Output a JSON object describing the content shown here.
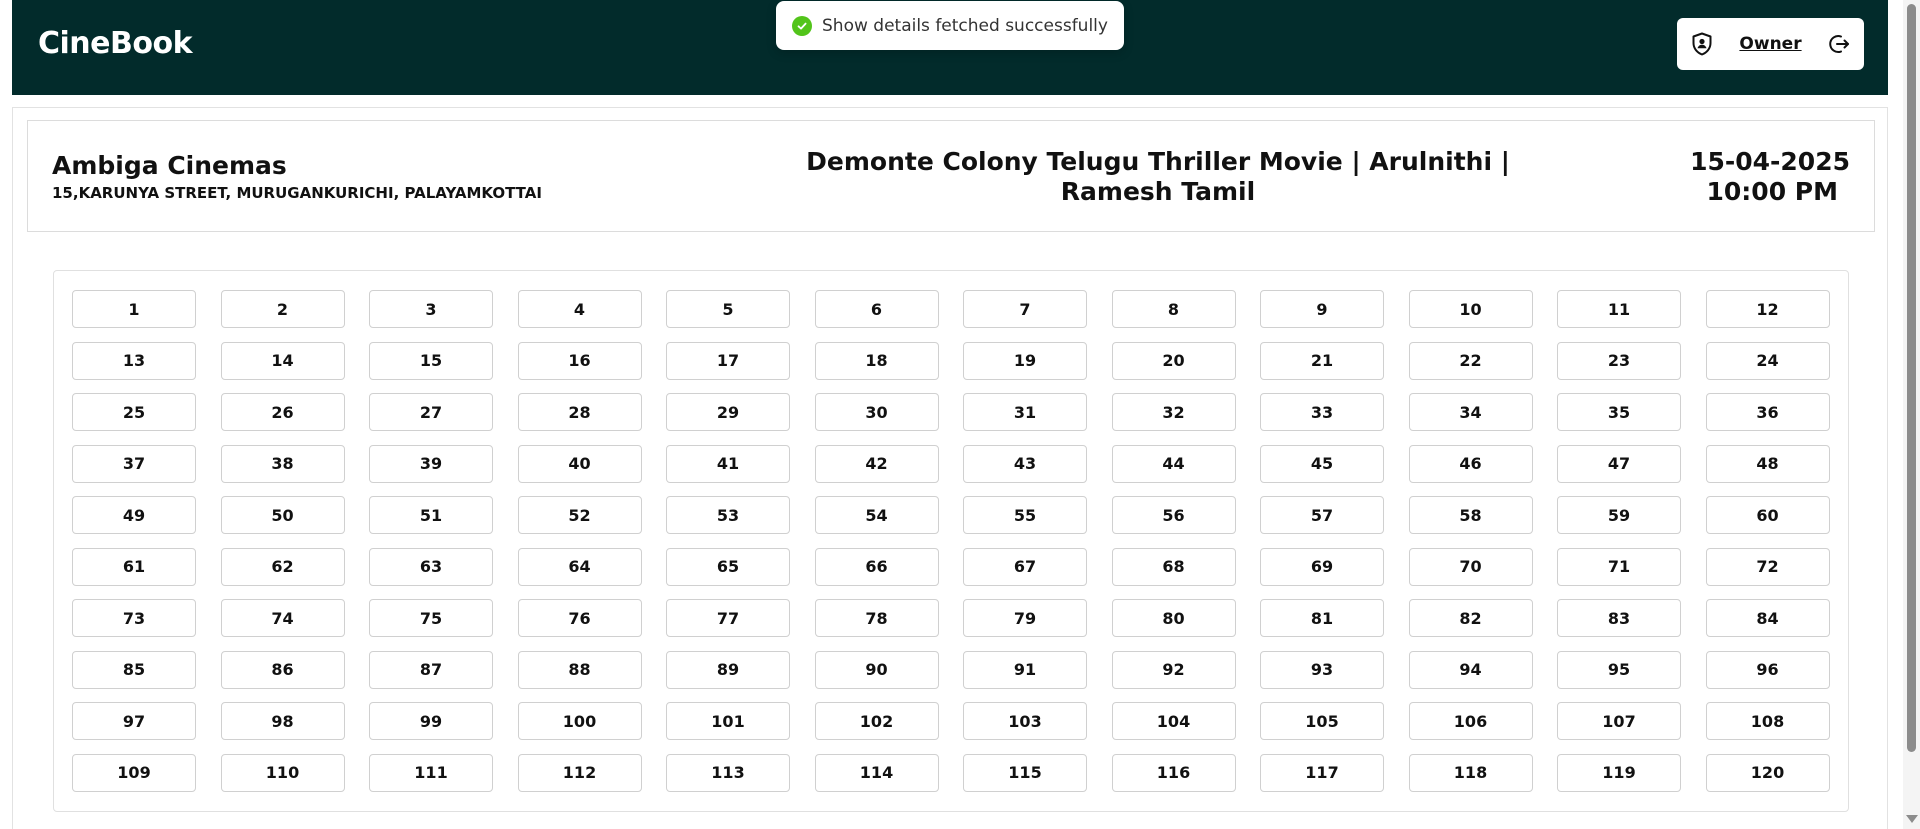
{
  "app": {
    "title": "CineBook"
  },
  "user": {
    "name": "Owner"
  },
  "toast": {
    "message": "Show details fetched successfully"
  },
  "show": {
    "theatre_name": "Ambiga Cinemas",
    "theatre_address": "15,KARUNYA STREET, MURUGANKURICHI, PALAYAMKOTTAI",
    "movie_title": "Demonte Colony Telugu Thriller Movie | Arulnithi | Ramesh Tamil",
    "date": "15-04-2025",
    "time": "10:00 PM"
  },
  "seats": [
    "1",
    "2",
    "3",
    "4",
    "5",
    "6",
    "7",
    "8",
    "9",
    "10",
    "11",
    "12",
    "13",
    "14",
    "15",
    "16",
    "17",
    "18",
    "19",
    "20",
    "21",
    "22",
    "23",
    "24",
    "25",
    "26",
    "27",
    "28",
    "29",
    "30",
    "31",
    "32",
    "33",
    "34",
    "35",
    "36",
    "37",
    "38",
    "39",
    "40",
    "41",
    "42",
    "43",
    "44",
    "45",
    "46",
    "47",
    "48",
    "49",
    "50",
    "51",
    "52",
    "53",
    "54",
    "55",
    "56",
    "57",
    "58",
    "59",
    "60",
    "61",
    "62",
    "63",
    "64",
    "65",
    "66",
    "67",
    "68",
    "69",
    "70",
    "71",
    "72",
    "73",
    "74",
    "75",
    "76",
    "77",
    "78",
    "79",
    "80",
    "81",
    "82",
    "83",
    "84",
    "85",
    "86",
    "87",
    "88",
    "89",
    "90",
    "91",
    "92",
    "93",
    "94",
    "95",
    "96",
    "97",
    "98",
    "99",
    "100",
    "101",
    "102",
    "103",
    "104",
    "105",
    "106",
    "107",
    "108",
    "109",
    "110",
    "111",
    "112",
    "113",
    "114",
    "115",
    "116",
    "117",
    "118",
    "119",
    "120"
  ],
  "icons": {
    "shield": "shield-user-icon",
    "logout": "logout-icon",
    "success": "check-circle-icon"
  },
  "colors": {
    "header_bg": "#022b2b",
    "success": "#52c41a"
  }
}
